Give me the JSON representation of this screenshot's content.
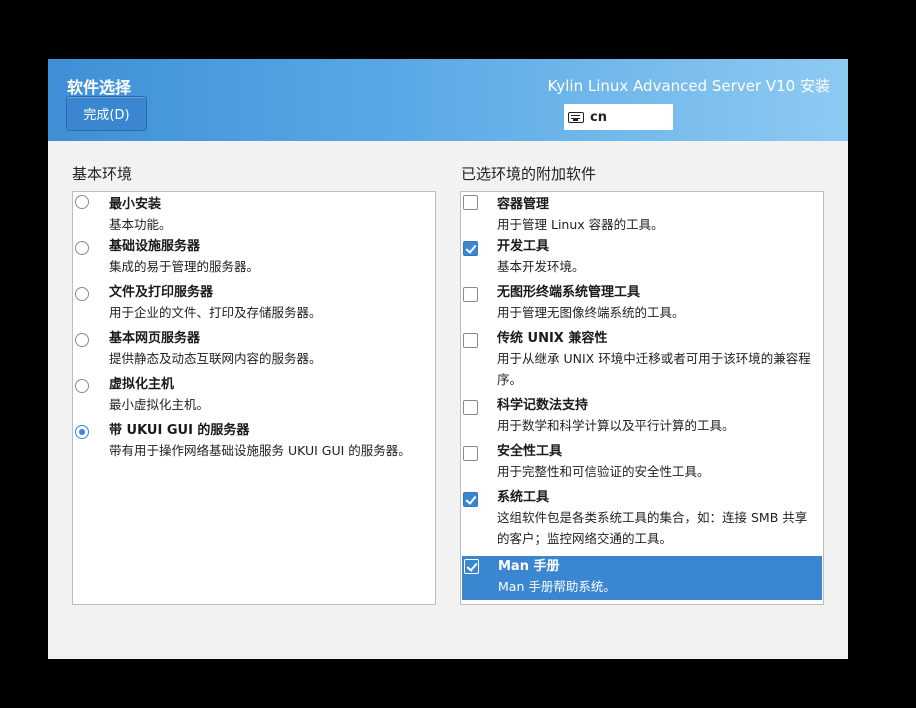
{
  "header": {
    "title": "软件选择",
    "done_button": "完成(D)",
    "product": "Kylin Linux Advanced Server V10 安装",
    "keyboard_layout": "cn",
    "keyboard_icon": "keyboard-icon"
  },
  "base_env": {
    "title": "基本环境",
    "items": [
      {
        "name": "最小安装",
        "desc": "基本功能。",
        "selected": false
      },
      {
        "name": "基础设施服务器",
        "desc": "集成的易于管理的服务器。",
        "selected": false
      },
      {
        "name": "文件及打印服务器",
        "desc": "用于企业的文件、打印及存储服务器。",
        "selected": false
      },
      {
        "name": "基本网页服务器",
        "desc": "提供静态及动态互联网内容的服务器。",
        "selected": false
      },
      {
        "name": "虚拟化主机",
        "desc": "最小虚拟化主机。",
        "selected": false
      },
      {
        "name": "带 UKUI GUI 的服务器",
        "desc": "带有用于操作网络基础设施服务 UKUI GUI 的服务器。",
        "selected": true
      }
    ]
  },
  "addons": {
    "title": "已选环境的附加软件",
    "items": [
      {
        "name": "容器管理",
        "desc": "用于管理 Linux 容器的工具。",
        "checked": false
      },
      {
        "name": "开发工具",
        "desc": "基本开发环境。",
        "checked": true
      },
      {
        "name": "无图形终端系统管理工具",
        "desc": "用于管理无图像终端系统的工具。",
        "checked": false
      },
      {
        "name": "传统 UNIX 兼容性",
        "desc": "用于从继承 UNIX 环境中迁移或者可用于该环境的兼容程序。",
        "checked": false
      },
      {
        "name": "科学记数法支持",
        "desc": "用于数学和科学计算以及平行计算的工具。",
        "checked": false
      },
      {
        "name": "安全性工具",
        "desc": "用于完整性和可信验证的安全性工具。",
        "checked": false
      },
      {
        "name": "系统工具",
        "desc": "这组软件包是各类系统工具的集合，如：连接 SMB 共享的客户；监控网络交通的工具。",
        "checked": true
      },
      {
        "name": "Man 手册",
        "desc": "Man 手册帮助系统。",
        "checked": true,
        "highlighted": true
      }
    ]
  },
  "colors": {
    "accent": "#3a86d1",
    "header_start": "#3f8fd6",
    "header_end": "#8ecaf2"
  }
}
